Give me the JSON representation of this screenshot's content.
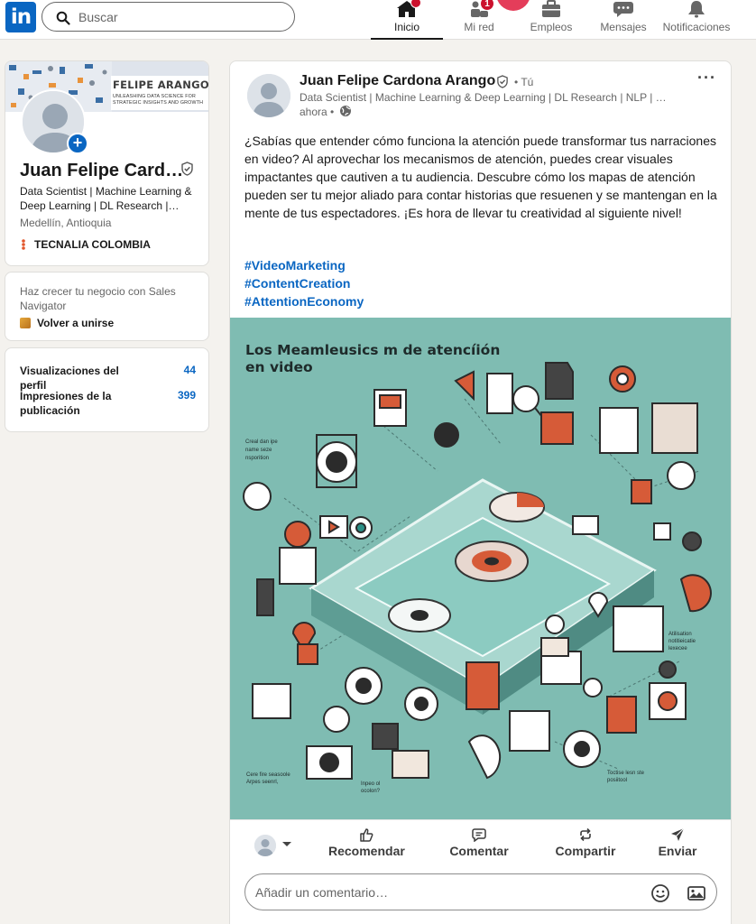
{
  "nav": {
    "search_placeholder": "Buscar",
    "items": [
      {
        "label": "Inicio",
        "icon": "home-icon",
        "badge": "",
        "active": true
      },
      {
        "label": "Mi red",
        "icon": "network-icon",
        "badge": "1"
      },
      {
        "label": "Empleos",
        "icon": "briefcase-icon",
        "badge": ""
      },
      {
        "label": "Mensajes",
        "icon": "messaging-icon",
        "badge": ""
      },
      {
        "label": "Notificaciones",
        "icon": "bell-icon",
        "badge": ""
      }
    ]
  },
  "profile": {
    "banner_name": "FELIPE ARANGO",
    "banner_line1": "UNLEASHING DATA SCIENCE FOR",
    "banner_line2": "STRATEGIC INSIGHTS AND GROWTH",
    "name": "Juan Felipe Card…",
    "headline": "Data Scientist | Machine Learning & Deep Learning | DL Research |…",
    "location": "Medellín, Antioquia",
    "company": "TECNALIA COLOMBIA"
  },
  "sales": {
    "text": "Haz crecer tu negocio con Sales Navigator",
    "link": "Volver a unirse"
  },
  "stats": [
    {
      "label": "Visualizaciones del perfil",
      "value": "44"
    },
    {
      "label": "Impresiones de la publicación",
      "value": "399"
    }
  ],
  "post": {
    "author": "Juan Felipe Cardona Arango",
    "author_tag": "• Tú",
    "headline": "Data Scientist | Machine Learning & Deep Learning | DL Research | NLP | …",
    "time": "ahora •",
    "more": "···",
    "text": "¿Sabías que entender cómo funciona la atención puede transformar tus narraciones en video? Al aprovechar los mecanismos de atención, puedes crear visuales impactantes que cautiven a tu audiencia. Descubre cómo los mapas de atención pueden ser tu mejor aliado para contar historias que resuenen y se mantengan en la mente de tus espectadores. ¡Es hora de llevar tu creatividad al siguiente nivel!",
    "hashtags": [
      "#VideoMarketing",
      "#ContentCreation",
      "#AttentionEconomy"
    ],
    "image_title": "Los Meamleusics m de atencíión en video",
    "actions": [
      {
        "label": "Recomendar",
        "icon": "thumbs-up-icon"
      },
      {
        "label": "Comentar",
        "icon": "comment-icon"
      },
      {
        "label": "Compartir",
        "icon": "repost-icon"
      },
      {
        "label": "Enviar",
        "icon": "send-icon"
      }
    ],
    "comment_placeholder": "Añadir un comentario…"
  },
  "colors": {
    "accent": "#0a66c2",
    "badge": "#cb112d",
    "image_bg": "#7fbcb2"
  }
}
